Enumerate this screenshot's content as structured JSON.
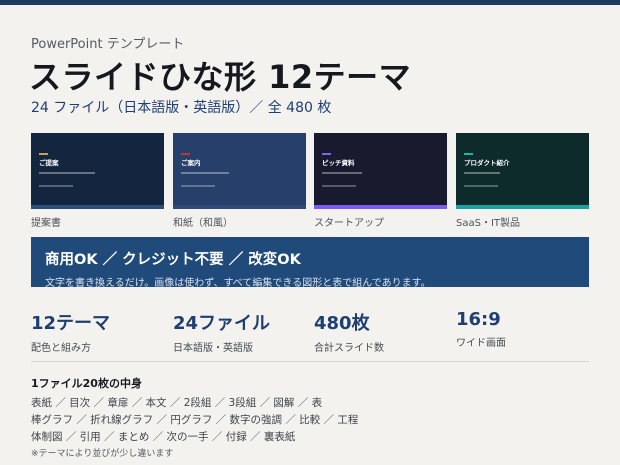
{
  "header": {
    "eyebrow": "PowerPoint テンプレート",
    "title": "スライドひな形 12テーマ",
    "subtitle": "24 ファイル（日本語版・英語版）／ 全 480 枚"
  },
  "thumbnails": [
    {
      "slide_title": "ご提案",
      "caption": "提案書",
      "bg": "#14253f",
      "accent": "#c8a24a",
      "band": "#2c4f7a"
    },
    {
      "slide_title": "ご案内",
      "caption": "和紙（和風）",
      "bg": "#27406b",
      "accent": "#c0392b",
      "band": "#2d4a7a"
    },
    {
      "slide_title": "ピッチ資料",
      "caption": "スタートアップ",
      "bg": "#181a2e",
      "accent": "#7b68ee",
      "band": "#7b5cf0"
    },
    {
      "slide_title": "プロダクト紹介",
      "caption": "SaaS・IT製品",
      "bg": "#0e2b2b",
      "accent": "#1fb5a5",
      "band": "#18a3a0"
    }
  ],
  "banner": {
    "main": "商用OK ／ クレジット不要 ／ 改変OK",
    "sub": "文字を書き換えるだけ。画像は使わず、すべて編集できる図形と表で組んであります。"
  },
  "stats": [
    {
      "value": "12テーマ",
      "label": "配色と組み方"
    },
    {
      "value": "24ファイル",
      "label": "日本語版・英語版"
    },
    {
      "value": "480枚",
      "label": "合計スライド数"
    },
    {
      "value": "16:9",
      "label": "ワイド画面"
    }
  ],
  "contents": {
    "heading": "1ファイル20枚の中身",
    "lines": [
      "表紙 ／ 目次 ／ 章扉 ／ 本文 ／ 2段組 ／ 3段組 ／ 図解 ／ 表",
      "棒グラフ ／ 折れ線グラフ ／ 円グラフ ／ 数字の強調 ／ 比較 ／ 工程",
      "体制図 ／ 引用 ／ まとめ ／ 次の一手 ／ 付録 ／ 裏表紙"
    ],
    "note": "※テーマにより並びが少し違います"
  }
}
